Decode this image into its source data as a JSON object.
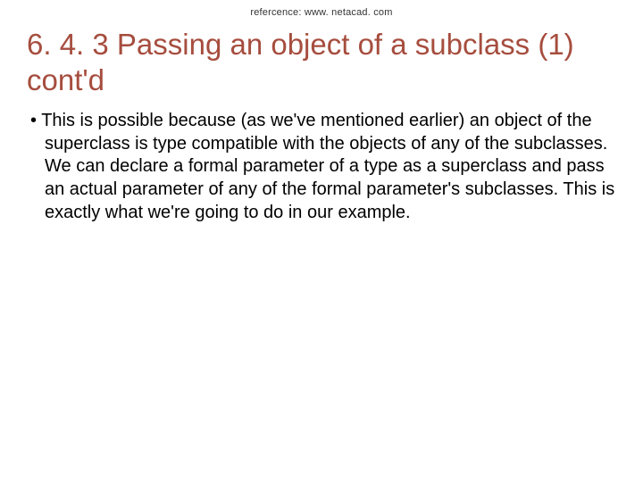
{
  "reference": "refercence: www. netacad. com",
  "title": "6. 4. 3 Passing an object of a subclass (1) cont'd",
  "body_text": "This is possible because (as we've mentioned earlier) an object of the superclass is type compatible with the objects of any of the subclasses. We can declare a formal parameter of a type as a superclass and pass an actual parameter of any of the formal parameter's subclasses. This is exactly what we're going to do in our example."
}
